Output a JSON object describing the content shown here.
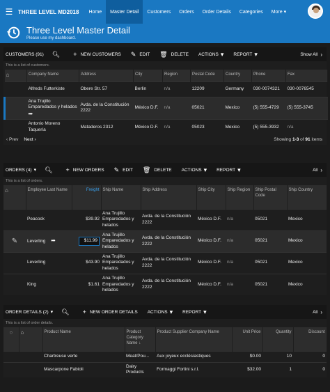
{
  "nav": {
    "menu_icon": "hamburger-icon",
    "brand": "THREE LEVEL MD2018",
    "items": [
      {
        "label": "Home",
        "active": false
      },
      {
        "label": "Master Detail",
        "active": true
      },
      {
        "label": "Customers",
        "active": false
      },
      {
        "label": "Orders",
        "active": false
      },
      {
        "label": "Order Details",
        "active": false
      },
      {
        "label": "Categories",
        "active": false
      },
      {
        "label": "More ▾",
        "active": false
      }
    ]
  },
  "header": {
    "title": "Three Level Master Detail",
    "subtitle": "Please use my dashboard.",
    "icon": "history-icon"
  },
  "customers": {
    "title": "CUSTOMERS (91)",
    "new_label": "NEW CUSTOMERS",
    "edit_label": "EDIT",
    "delete_label": "DELETE",
    "actions_label": "ACTIONS",
    "report_label": "REPORT",
    "all_label": "Show All",
    "all_short": "All",
    "description": "This is a list of customers.",
    "columns": [
      "Company Name",
      "Address",
      "City",
      "Region",
      "Postal Code",
      "Country",
      "Phone",
      "Fax"
    ],
    "rows": [
      {
        "company": "Alfreds Futterkiste",
        "address": "Obere Str. 57",
        "city": "Berlin",
        "region": "n/a",
        "postal": "12209",
        "country": "Germany",
        "phone": "030-0074321",
        "fax": "030-0076545"
      },
      {
        "company": "Ana Trujillo Emparedados y helados",
        "address": "Avda. de la Constitución 2222",
        "city": "México D.F.",
        "region": "n/a",
        "postal": "05021",
        "country": "Mexico",
        "phone": "(5) 555-4729",
        "fax": "(5) 555-3745"
      },
      {
        "company": "Antonio Moreno Taquería",
        "address": "Mataderos 2312",
        "city": "México D.F.",
        "region": "n/a",
        "postal": "05023",
        "country": "Mexico",
        "phone": "(5) 555-3932",
        "fax": "n/a"
      }
    ],
    "pager": {
      "prev": "Prev",
      "next": "Next",
      "showing_prefix": "Showing ",
      "range": "1-3",
      "of": " of ",
      "total": "91",
      "suffix": " items"
    }
  },
  "orders": {
    "title": "ORDERS (4)",
    "new_label": "NEW ORDERS",
    "edit_label": "EDIT",
    "delete_label": "DELETE",
    "actions_label": "ACTIONS",
    "report_label": "REPORT",
    "all_short": "All",
    "description": "This is a list of orders.",
    "columns": [
      "Employee Last Name",
      "Freight",
      "Ship Name",
      "Ship Address",
      "Ship City",
      "Ship Region",
      "Ship Postal Code",
      "Ship Country"
    ],
    "rows": [
      {
        "employee": "Peacock",
        "freight": "$39.92",
        "ship_name": "Ana Trujillo Emparedados y helados",
        "ship_address": "Avda. de la Constitución 2222",
        "ship_city": "México D.F.",
        "ship_region": "n/a",
        "ship_postal": "05021",
        "ship_country": "Mexico"
      },
      {
        "employee": "Leverling",
        "freight": "$11.99",
        "ship_name": "Ana Trujillo Emparedados y helados",
        "ship_address": "Avda. de la Constitución 2222",
        "ship_city": "México D.F.",
        "ship_region": "n/a",
        "ship_postal": "05021",
        "ship_country": "Mexico"
      },
      {
        "employee": "Leverling",
        "freight": "$43.90",
        "ship_name": "Ana Trujillo Emparedados y helados",
        "ship_address": "Avda. de la Constitución 2222",
        "ship_city": "México D.F.",
        "ship_region": "n/a",
        "ship_postal": "05021",
        "ship_country": "Mexico"
      },
      {
        "employee": "King",
        "freight": "$1.61",
        "ship_name": "Ana Trujillo Emparedados y helados",
        "ship_address": "Avda. de la Constitución 2222",
        "ship_city": "México D.F.",
        "ship_region": "n/a",
        "ship_postal": "05021",
        "ship_country": "Mexico"
      }
    ]
  },
  "details": {
    "title": "ORDER DETAILS (2)",
    "new_label": "NEW ORDER DETAILS",
    "actions_label": "ACTIONS",
    "report_label": "REPORT",
    "all_short": "All",
    "description": "This is a list of order details.",
    "columns": [
      "Product Name",
      "Product Category Name",
      "Product Supplier Company Name",
      "Unit Price",
      "Quantity",
      "Discount"
    ],
    "rows": [
      {
        "product": "Chartreuse verte",
        "category": "Meat/Pou...",
        "supplier": "Aux joyeux ecclésiastiques",
        "price": "$0.00",
        "qty": "10",
        "discount": "0"
      },
      {
        "product": "Mascarpone Fabioli",
        "category": "Dairy Products",
        "supplier": "Formaggi Fortini s.r.l.",
        "price": "$32.00",
        "qty": "1",
        "discount": "0"
      }
    ]
  },
  "colors": {
    "accent": "#1a78c2",
    "background": "#1b1b1b",
    "header_row": "#2d2d2d"
  }
}
